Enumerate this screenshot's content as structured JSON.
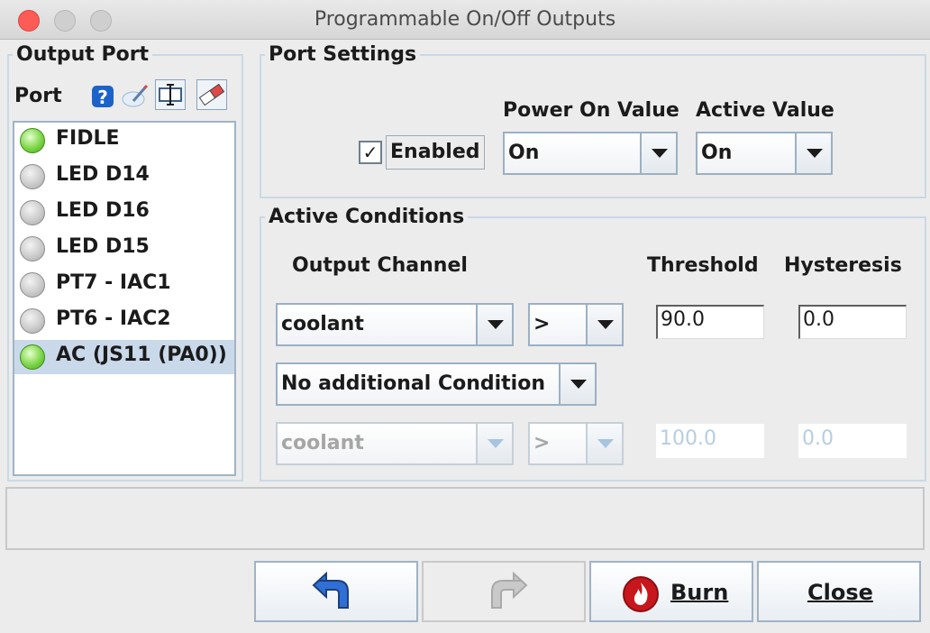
{
  "window": {
    "title": "Programmable On/Off Outputs"
  },
  "output_port": {
    "legend": "Output Port",
    "port_label": "Port",
    "toolbar_icons": [
      "help-icon",
      "edit-icon",
      "text-field-icon",
      "eraser-icon"
    ],
    "ports": [
      {
        "name": "FIDLE",
        "active": true,
        "selected": false
      },
      {
        "name": "LED D14",
        "active": false,
        "selected": false
      },
      {
        "name": "LED D16",
        "active": false,
        "selected": false
      },
      {
        "name": "LED D15",
        "active": false,
        "selected": false
      },
      {
        "name": "PT7 - IAC1",
        "active": false,
        "selected": false
      },
      {
        "name": "PT6 - IAC2",
        "active": false,
        "selected": false
      },
      {
        "name": "AC (JS11 (PA0))",
        "active": true,
        "selected": true
      }
    ]
  },
  "port_settings": {
    "legend": "Port Settings",
    "enabled_label": "Enabled",
    "enabled_checked": true,
    "power_on_value_label": "Power On Value",
    "power_on_value": "On",
    "active_value_label": "Active Value",
    "active_value": "On"
  },
  "active_conditions": {
    "legend": "Active Conditions",
    "output_channel_label": "Output Channel",
    "threshold_label": "Threshold",
    "hysteresis_label": "Hysteresis",
    "condition1": {
      "channel": "coolant",
      "operator": ">",
      "threshold": "90.0",
      "hysteresis": "0.0"
    },
    "additional_condition": "No additional Condition",
    "condition2": {
      "channel": "coolant",
      "operator": ">",
      "threshold": "100.0",
      "hysteresis": "0.0"
    }
  },
  "buttons": {
    "undo_icon": "undo-arrow-icon",
    "redo_icon": "redo-arrow-icon",
    "burn_label": "Burn",
    "burn_icon": "flame-icon",
    "close_label": "Close"
  },
  "colors": {
    "active_led": "#7ed648",
    "selected_row": "#c9d9ea",
    "burn_icon": "#c8161d"
  }
}
